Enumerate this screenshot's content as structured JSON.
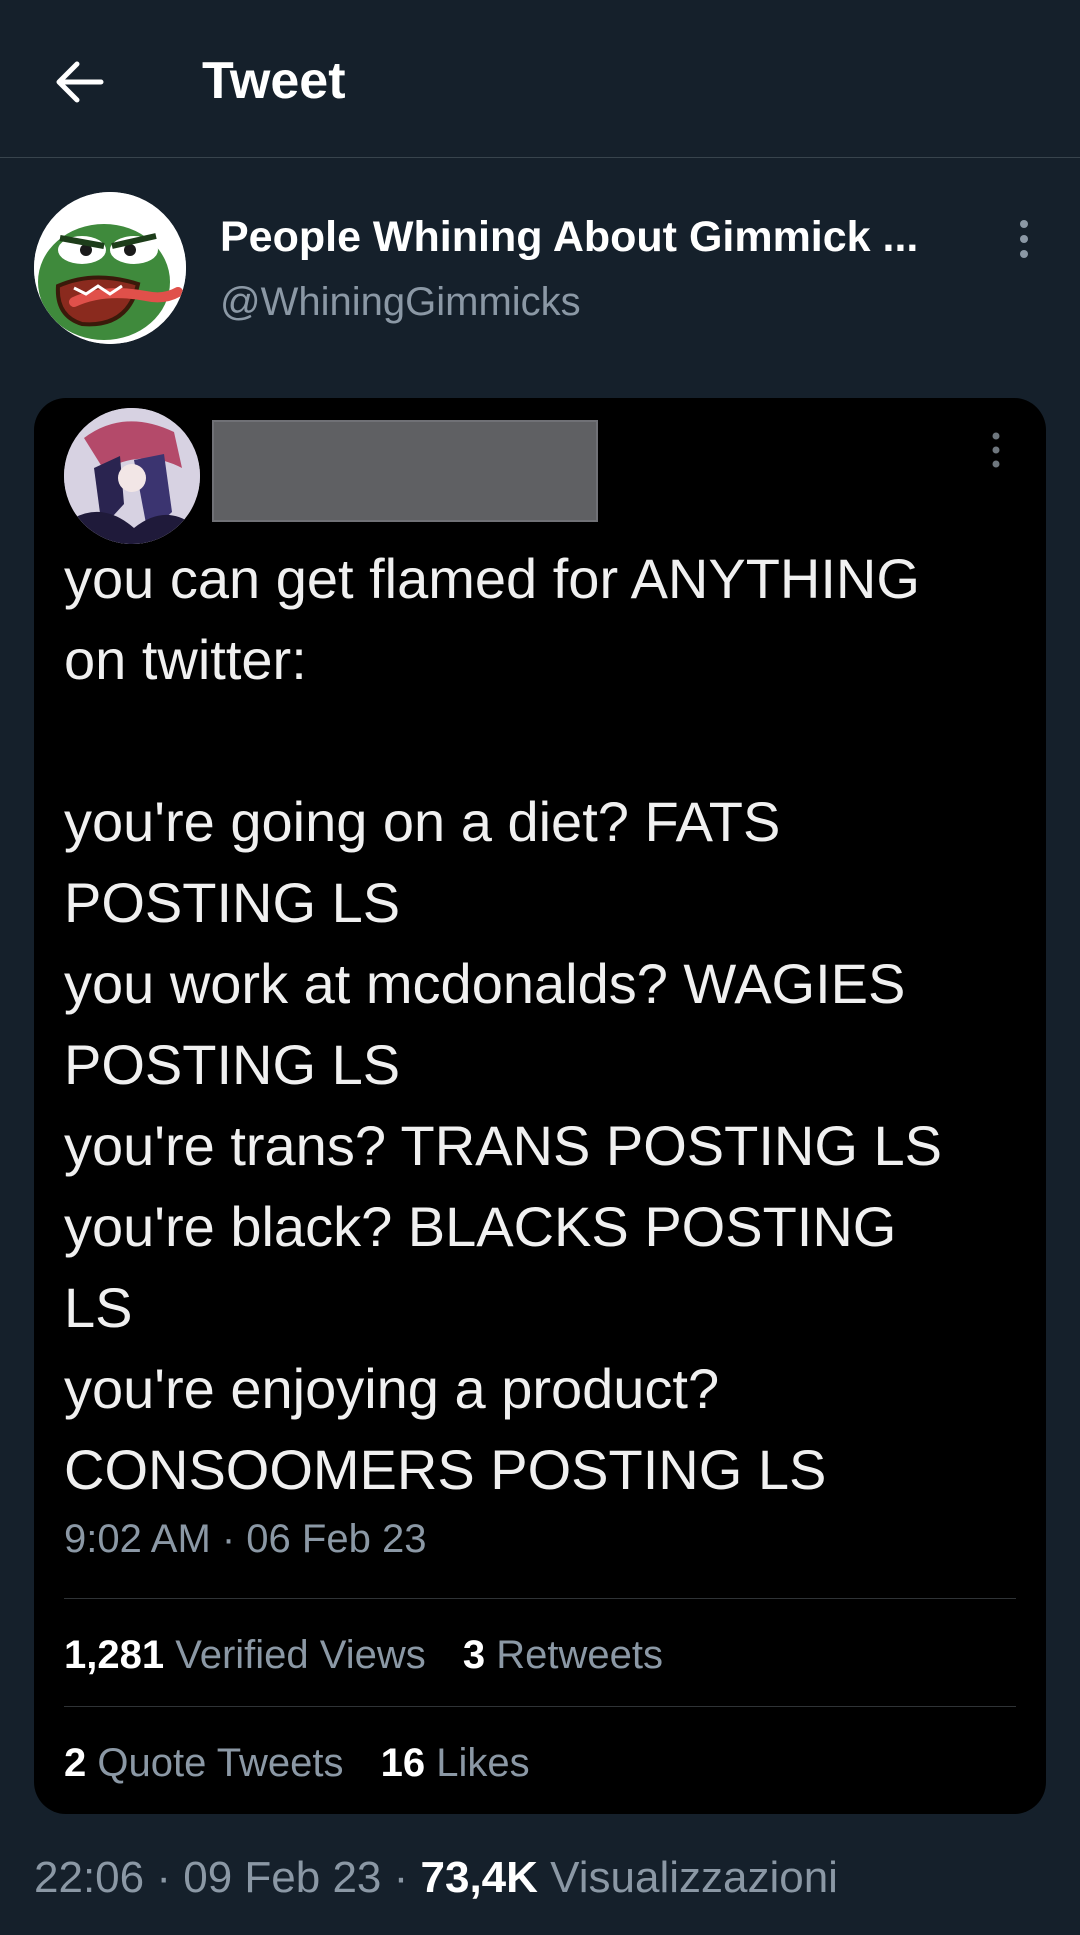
{
  "header": {
    "back_icon": "arrow-left-icon",
    "title": "Tweet"
  },
  "author": {
    "name": "People Whining About Gimmick ...",
    "handle": "@WhiningGimmicks",
    "avatar_icon": "frog-avatar-icon",
    "more_icon": "more-vertical-icon"
  },
  "embedded_tweet": {
    "lines": [
      "you can get flamed for ANYTHING",
      "on twitter:",
      "",
      "you're going on a diet? FATS",
      "POSTING LS",
      "you work at mcdonalds? WAGIES",
      "POSTING LS",
      "you're trans? TRANS POSTING LS",
      "you're black? BLACKS POSTING",
      "LS",
      "you're enjoying a product?",
      "CONSOOMERS POSTING LS"
    ],
    "timestamp": "9:02 AM · 06 Feb 23",
    "stats": {
      "views_count": "1,281",
      "views_label": "Verified Views",
      "retweets_count": "3",
      "retweets_label": "Retweets",
      "quotes_count": "2",
      "quotes_label": "Quote Tweets",
      "likes_count": "16",
      "likes_label": "Likes"
    }
  },
  "footer": {
    "time": "22:06",
    "date": "09 Feb 23",
    "separator": "·",
    "views_count": "73,4K",
    "views_label": "Visualizzazioni"
  },
  "colors": {
    "background": "#15202b",
    "card": "#000000",
    "secondary_text": "#8b98a5",
    "divider": "#38444d"
  }
}
